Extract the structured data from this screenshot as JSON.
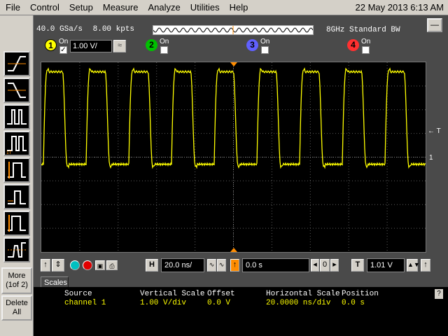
{
  "menu": {
    "items": [
      "File",
      "Control",
      "Setup",
      "Measure",
      "Analyze",
      "Utilities",
      "Help"
    ],
    "datetime": "22 May 2013  6:13 AM"
  },
  "acquisition": {
    "sample_rate": "40.0 GSa/s",
    "points": "8.00 kpts",
    "bandwidth": "8GHz Standard BW"
  },
  "channels": [
    {
      "number": "1",
      "on_label": "On",
      "checked": true,
      "color": "#ffff00",
      "scale": "1.00 V/"
    },
    {
      "number": "2",
      "on_label": "On",
      "checked": false,
      "color": "#00c000"
    },
    {
      "number": "3",
      "on_label": "On",
      "checked": false,
      "color": "#6060ff"
    },
    {
      "number": "4",
      "on_label": "On",
      "checked": false,
      "color": "#ff3030"
    }
  ],
  "left_toolbar": {
    "more_label_1": "More",
    "more_label_2": "(1of 2)",
    "delete_label_1": "Delete",
    "delete_label_2": "All",
    "icons": [
      "rising-edge-trigger-icon",
      "falling-edge-trigger-icon",
      "glitch-trigger-icon",
      "pulse-width-trigger-icon",
      "setup-hold-trigger-icon",
      "runt-trigger-icon",
      "transition-trigger-icon",
      "timeout-trigger-icon"
    ]
  },
  "controls": {
    "horizontal_button": "H",
    "horizontal_scale": "20.0 ns/",
    "position": "0.0 s",
    "trigger_button": "T",
    "trigger_level": "1.01 V"
  },
  "markers": {
    "trigger_level": "← T",
    "ground": "1"
  },
  "scales_tab": {
    "label": "Scales",
    "headers": {
      "source": "Source",
      "vertical_scale": "Vertical Scale",
      "offset": "Offset",
      "horizontal_scale": "Horizontal Scale",
      "position": "Position"
    },
    "values": {
      "source": "channel 1",
      "vertical_scale": "1.00 V/div",
      "offset": "0.0 V",
      "horizontal_scale": "20.0000 ns/div",
      "position": "0.0 s"
    }
  },
  "colors": {
    "trace": "#ffff00",
    "background": "#000000",
    "grid": "#5a5a5a",
    "trigger_marker": "#ff8c00"
  },
  "waveform": {
    "cycles_visible": 9,
    "high_level_div": 3.6,
    "low_level_div": -0.3,
    "offset_div": 0
  }
}
